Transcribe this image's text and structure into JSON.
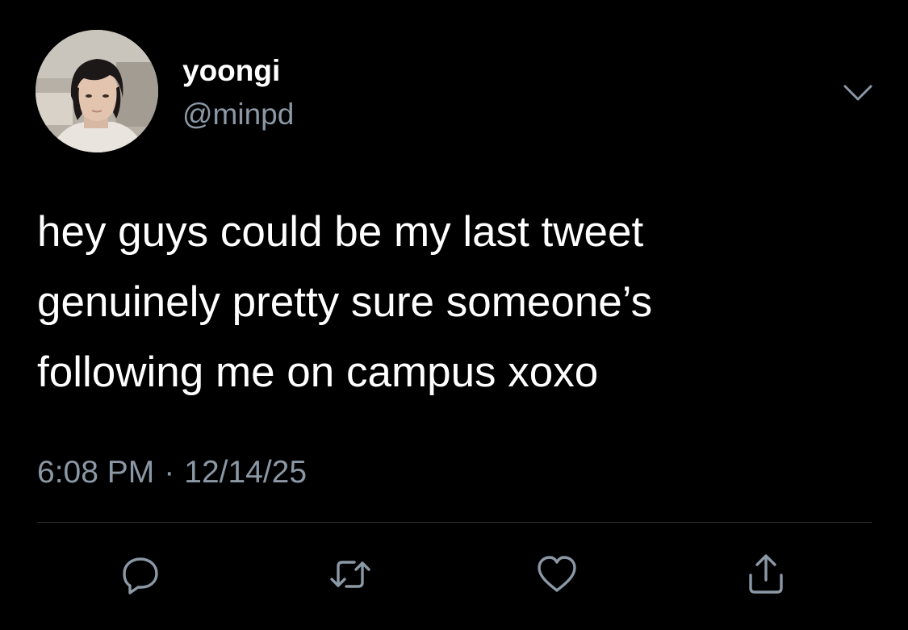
{
  "user": {
    "display_name": "yoongi",
    "handle": "@minpd"
  },
  "tweet": {
    "lines": [
      "hey guys could be my last tweet",
      "genuinely pretty sure someone’s",
      "following me on campus xoxo"
    ],
    "time": "6:08 PM",
    "separator": "·",
    "date": "12/14/25"
  },
  "actions": {
    "reply_icon": "speech-bubble",
    "retweet_icon": "retweet-arrows",
    "like_icon": "heart-outline",
    "share_icon": "share-upload"
  },
  "colors": {
    "background": "#000000",
    "primary_text": "#ffffff",
    "secondary_text": "#8b98a5",
    "divider": "#2f3336",
    "icon": "#8b98a5"
  }
}
